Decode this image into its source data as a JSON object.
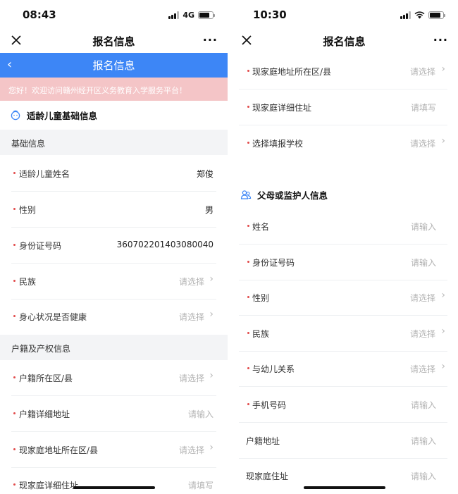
{
  "left": {
    "status": {
      "time": "08:43",
      "network": "4G"
    },
    "nav": {
      "title": "报名信息",
      "more": "···"
    },
    "header": {
      "title": "报名信息",
      "back": "‹"
    },
    "notice": "您好！欢迎访问赣州经开区义务教育入学服务平台！",
    "section": "适龄儿童基础信息",
    "group_basic": "基础信息",
    "group_household": "户籍及产权信息",
    "rows": [
      {
        "label": "适龄儿童姓名",
        "value": "郑俊"
      },
      {
        "label": "性别",
        "value": "男"
      },
      {
        "label": "身份证号码",
        "value": "360702201403080040"
      },
      {
        "label": "民族",
        "placeholder": "请选择"
      },
      {
        "label": "身心状况是否健康",
        "placeholder": "请选择"
      },
      {
        "label": "户籍所在区/县",
        "placeholder": "请选择"
      },
      {
        "label": "户籍详细地址",
        "placeholder": "请输入"
      },
      {
        "label": "现家庭地址所在区/县",
        "placeholder": "请选择"
      },
      {
        "label": "现家庭详细住址",
        "placeholder": "请填写"
      }
    ]
  },
  "right": {
    "status": {
      "time": "10:30"
    },
    "nav": {
      "title": "报名信息",
      "more": "···"
    },
    "section": "父母或监护人信息",
    "rows": [
      {
        "label": "现家庭地址所在区/县",
        "placeholder": "请选择"
      },
      {
        "label": "现家庭详细住址",
        "placeholder": "请填写"
      },
      {
        "label": "选择填报学校",
        "placeholder": "请选择"
      },
      {
        "label": "姓名",
        "placeholder": "请输入"
      },
      {
        "label": "身份证号码",
        "placeholder": "请输入"
      },
      {
        "label": "性别",
        "placeholder": "请选择"
      },
      {
        "label": "民族",
        "placeholder": "请选择"
      },
      {
        "label": "与幼儿关系",
        "placeholder": "请选择"
      },
      {
        "label": "手机号码",
        "placeholder": "请输入"
      },
      {
        "label": "户籍地址",
        "placeholder": "请输入"
      },
      {
        "label": "现家庭住址",
        "placeholder": "请输入"
      }
    ]
  },
  "arrow_glyph": "›",
  "colors": {
    "primary": "#3d86f6",
    "notice_bg": "#f4c5c7",
    "required_dot": "#e24b4b",
    "placeholder": "#b3b3b3"
  }
}
